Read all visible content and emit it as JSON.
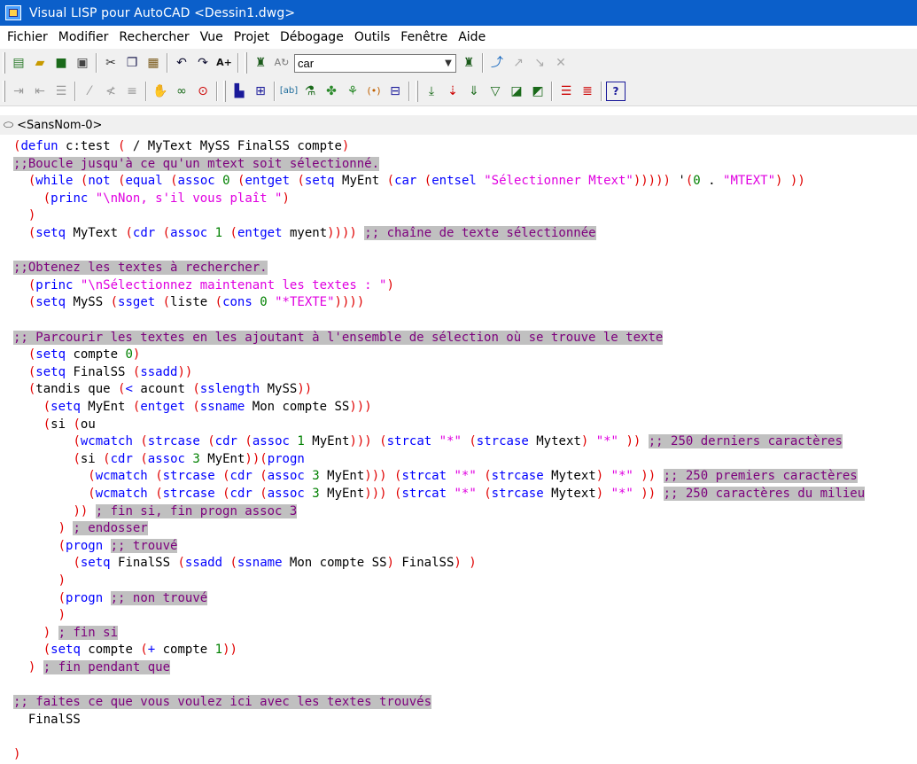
{
  "window": {
    "title": "Visual LISP pour AutoCAD <Dessin1.dwg>"
  },
  "menu": [
    "Fichier",
    "Modifier",
    "Rechercher",
    "Vue",
    "Projet",
    "Débogage",
    "Outils",
    "Fenêtre",
    "Aide"
  ],
  "toolbar": {
    "search_combo_value": "car",
    "row1_buttons": [
      "new-file-icon",
      "open-icon",
      "save-icon",
      "print-icon",
      "cut-icon",
      "copy-icon",
      "paste-icon",
      "undo-icon",
      "redo-icon",
      "complete-word-icon",
      "find-icon",
      "replace-icon",
      "find-toolbar-icon",
      "toggle-bookmark-icon",
      "next-bookmark-icon",
      "clear-bookmarks-icon"
    ],
    "row2_buttons": [
      "indent-icon",
      "unindent-icon",
      "indent-block-icon",
      "comment-icon",
      "uncomment-icon",
      "format-icon",
      "load-selection-icon",
      "check-selection-icon",
      "load-file-icon",
      "activate-autocad-icon",
      "build-output-icon",
      "inspect-icon",
      "watch-icon",
      "apropos-icon",
      "trace-icon",
      "console-icon",
      "step-into-icon",
      "step-over-icon",
      "step-out-icon",
      "continue-icon",
      "quit-icon",
      "reset-icon",
      "toggle-breakpoint-icon",
      "last-break-icon",
      "help-icon"
    ]
  },
  "tab": {
    "label": "<SansNom-0>"
  },
  "code": [
    [
      [
        "p",
        "("
      ],
      [
        "f",
        "defun"
      ],
      [
        "s",
        " c:test "
      ],
      [
        "p",
        "("
      ],
      [
        "s",
        " / MyText MySS FinalSS compte"
      ],
      [
        "p",
        ")"
      ]
    ],
    [
      [
        "c",
        ";;Boucle jusqu'à ce qu'un mtext soit sélectionné."
      ]
    ],
    [
      [
        "s",
        "  "
      ],
      [
        "p",
        "("
      ],
      [
        "f",
        "while"
      ],
      [
        "s",
        " "
      ],
      [
        "p",
        "("
      ],
      [
        "f",
        "not"
      ],
      [
        "s",
        " "
      ],
      [
        "p",
        "("
      ],
      [
        "f",
        "equal"
      ],
      [
        "s",
        " "
      ],
      [
        "p",
        "("
      ],
      [
        "f",
        "assoc"
      ],
      [
        "s",
        " "
      ],
      [
        "n",
        "0"
      ],
      [
        "s",
        " "
      ],
      [
        "p",
        "("
      ],
      [
        "f",
        "entget"
      ],
      [
        "s",
        " "
      ],
      [
        "p",
        "("
      ],
      [
        "f",
        "setq"
      ],
      [
        "s",
        " MyEnt "
      ],
      [
        "p",
        "("
      ],
      [
        "f",
        "car"
      ],
      [
        "s",
        " "
      ],
      [
        "p",
        "("
      ],
      [
        "f",
        "entsel"
      ],
      [
        "s",
        " "
      ],
      [
        "t",
        "\"Sélectionner Mtext\""
      ],
      [
        "p",
        ")))))"
      ],
      [
        "s",
        " '"
      ],
      [
        "p",
        "("
      ],
      [
        "n",
        "0"
      ],
      [
        "s",
        " . "
      ],
      [
        "t",
        "\"MTEXT\""
      ],
      [
        "p",
        ")"
      ],
      [
        "s",
        " "
      ],
      [
        "p",
        "))"
      ]
    ],
    [
      [
        "s",
        "    "
      ],
      [
        "p",
        "("
      ],
      [
        "f",
        "princ"
      ],
      [
        "s",
        " "
      ],
      [
        "t",
        "\"\\nNon, s'il vous plaît \""
      ],
      [
        "p",
        ")"
      ]
    ],
    [
      [
        "s",
        "  "
      ],
      [
        "p",
        ")"
      ]
    ],
    [
      [
        "s",
        "  "
      ],
      [
        "p",
        "("
      ],
      [
        "f",
        "setq"
      ],
      [
        "s",
        " MyText "
      ],
      [
        "p",
        "("
      ],
      [
        "f",
        "cdr"
      ],
      [
        "s",
        " "
      ],
      [
        "p",
        "("
      ],
      [
        "f",
        "assoc"
      ],
      [
        "s",
        " "
      ],
      [
        "n",
        "1"
      ],
      [
        "s",
        " "
      ],
      [
        "p",
        "("
      ],
      [
        "f",
        "entget"
      ],
      [
        "s",
        " myent"
      ],
      [
        "p",
        "))))"
      ],
      [
        "s",
        " "
      ],
      [
        "c",
        ";; chaîne de texte sélectionnée"
      ]
    ],
    [],
    [
      [
        "c",
        ";;Obtenez les textes à rechercher."
      ]
    ],
    [
      [
        "s",
        "  "
      ],
      [
        "p",
        "("
      ],
      [
        "f",
        "princ"
      ],
      [
        "s",
        " "
      ],
      [
        "t",
        "\"\\nSélectionnez maintenant les textes : \""
      ],
      [
        "p",
        ")"
      ]
    ],
    [
      [
        "s",
        "  "
      ],
      [
        "p",
        "("
      ],
      [
        "f",
        "setq"
      ],
      [
        "s",
        " MySS "
      ],
      [
        "p",
        "("
      ],
      [
        "f",
        "ssget"
      ],
      [
        "s",
        " "
      ],
      [
        "p",
        "("
      ],
      [
        "s",
        "liste "
      ],
      [
        "p",
        "("
      ],
      [
        "f",
        "cons"
      ],
      [
        "s",
        " "
      ],
      [
        "n",
        "0"
      ],
      [
        "s",
        " "
      ],
      [
        "t",
        "\"*TEXTE\""
      ],
      [
        "p",
        "))))"
      ]
    ],
    [],
    [
      [
        "c",
        ";; Parcourir les textes en les ajoutant à l'ensemble de sélection où se trouve le texte"
      ]
    ],
    [
      [
        "s",
        "  "
      ],
      [
        "p",
        "("
      ],
      [
        "f",
        "setq"
      ],
      [
        "s",
        " compte "
      ],
      [
        "n",
        "0"
      ],
      [
        "p",
        ")"
      ]
    ],
    [
      [
        "s",
        "  "
      ],
      [
        "p",
        "("
      ],
      [
        "f",
        "setq"
      ],
      [
        "s",
        " FinalSS "
      ],
      [
        "p",
        "("
      ],
      [
        "f",
        "ssadd"
      ],
      [
        "p",
        "))"
      ]
    ],
    [
      [
        "s",
        "  "
      ],
      [
        "p",
        "("
      ],
      [
        "s",
        "tandis que "
      ],
      [
        "p",
        "("
      ],
      [
        "f",
        "<"
      ],
      [
        "s",
        " acount "
      ],
      [
        "p",
        "("
      ],
      [
        "f",
        "sslength"
      ],
      [
        "s",
        " MySS"
      ],
      [
        "p",
        "))"
      ]
    ],
    [
      [
        "s",
        "    "
      ],
      [
        "p",
        "("
      ],
      [
        "f",
        "setq"
      ],
      [
        "s",
        " MyEnt "
      ],
      [
        "p",
        "("
      ],
      [
        "f",
        "entget"
      ],
      [
        "s",
        " "
      ],
      [
        "p",
        "("
      ],
      [
        "f",
        "ssname"
      ],
      [
        "s",
        " Mon compte SS"
      ],
      [
        "p",
        ")))"
      ]
    ],
    [
      [
        "s",
        "    "
      ],
      [
        "p",
        "("
      ],
      [
        "s",
        "si "
      ],
      [
        "p",
        "("
      ],
      [
        "s",
        "ou"
      ]
    ],
    [
      [
        "s",
        "        "
      ],
      [
        "p",
        "("
      ],
      [
        "f",
        "wcmatch"
      ],
      [
        "s",
        " "
      ],
      [
        "p",
        "("
      ],
      [
        "f",
        "strcase"
      ],
      [
        "s",
        " "
      ],
      [
        "p",
        "("
      ],
      [
        "f",
        "cdr"
      ],
      [
        "s",
        " "
      ],
      [
        "p",
        "("
      ],
      [
        "f",
        "assoc"
      ],
      [
        "s",
        " "
      ],
      [
        "n",
        "1"
      ],
      [
        "s",
        " MyEnt"
      ],
      [
        "p",
        ")))"
      ],
      [
        "s",
        " "
      ],
      [
        "p",
        "("
      ],
      [
        "f",
        "strcat"
      ],
      [
        "s",
        " "
      ],
      [
        "t",
        "\"*\""
      ],
      [
        "s",
        " "
      ],
      [
        "p",
        "("
      ],
      [
        "f",
        "strcase"
      ],
      [
        "s",
        " Mytext"
      ],
      [
        "p",
        ")"
      ],
      [
        "s",
        " "
      ],
      [
        "t",
        "\"*\""
      ],
      [
        "s",
        " "
      ],
      [
        "p",
        "))"
      ],
      [
        "s",
        " "
      ],
      [
        "c",
        ";; 250 derniers caractères"
      ]
    ],
    [
      [
        "s",
        "        "
      ],
      [
        "p",
        "("
      ],
      [
        "s",
        "si "
      ],
      [
        "p",
        "("
      ],
      [
        "f",
        "cdr"
      ],
      [
        "s",
        " "
      ],
      [
        "p",
        "("
      ],
      [
        "f",
        "assoc"
      ],
      [
        "s",
        " "
      ],
      [
        "n",
        "3"
      ],
      [
        "s",
        " MyEnt"
      ],
      [
        "p",
        "))("
      ],
      [
        "f",
        "progn"
      ]
    ],
    [
      [
        "s",
        "          "
      ],
      [
        "p",
        "("
      ],
      [
        "f",
        "wcmatch"
      ],
      [
        "s",
        " "
      ],
      [
        "p",
        "("
      ],
      [
        "f",
        "strcase"
      ],
      [
        "s",
        " "
      ],
      [
        "p",
        "("
      ],
      [
        "f",
        "cdr"
      ],
      [
        "s",
        " "
      ],
      [
        "p",
        "("
      ],
      [
        "f",
        "assoc"
      ],
      [
        "s",
        " "
      ],
      [
        "n",
        "3"
      ],
      [
        "s",
        " MyEnt"
      ],
      [
        "p",
        ")))"
      ],
      [
        "s",
        " "
      ],
      [
        "p",
        "("
      ],
      [
        "f",
        "strcat"
      ],
      [
        "s",
        " "
      ],
      [
        "t",
        "\"*\""
      ],
      [
        "s",
        " "
      ],
      [
        "p",
        "("
      ],
      [
        "f",
        "strcase"
      ],
      [
        "s",
        " Mytext"
      ],
      [
        "p",
        ")"
      ],
      [
        "s",
        " "
      ],
      [
        "t",
        "\"*\""
      ],
      [
        "s",
        " "
      ],
      [
        "p",
        "))"
      ],
      [
        "s",
        " "
      ],
      [
        "c",
        ";; 250 premiers caractères"
      ]
    ],
    [
      [
        "s",
        "          "
      ],
      [
        "p",
        "("
      ],
      [
        "f",
        "wcmatch"
      ],
      [
        "s",
        " "
      ],
      [
        "p",
        "("
      ],
      [
        "f",
        "strcase"
      ],
      [
        "s",
        " "
      ],
      [
        "p",
        "("
      ],
      [
        "f",
        "cdr"
      ],
      [
        "s",
        " "
      ],
      [
        "p",
        "("
      ],
      [
        "f",
        "assoc"
      ],
      [
        "s",
        " "
      ],
      [
        "n",
        "3"
      ],
      [
        "s",
        " MyEnt"
      ],
      [
        "p",
        ")))"
      ],
      [
        "s",
        " "
      ],
      [
        "p",
        "("
      ],
      [
        "f",
        "strcat"
      ],
      [
        "s",
        " "
      ],
      [
        "t",
        "\"*\""
      ],
      [
        "s",
        " "
      ],
      [
        "p",
        "("
      ],
      [
        "f",
        "strcase"
      ],
      [
        "s",
        " Mytext"
      ],
      [
        "p",
        ")"
      ],
      [
        "s",
        " "
      ],
      [
        "t",
        "\"*\""
      ],
      [
        "s",
        " "
      ],
      [
        "p",
        "))"
      ],
      [
        "s",
        " "
      ],
      [
        "c",
        ";; 250 caractères du milieu"
      ]
    ],
    [
      [
        "s",
        "        "
      ],
      [
        "p",
        "))"
      ],
      [
        "s",
        " "
      ],
      [
        "c",
        "; fin si, fin progn assoc 3"
      ]
    ],
    [
      [
        "s",
        "      "
      ],
      [
        "p",
        ")"
      ],
      [
        "s",
        " "
      ],
      [
        "c",
        "; endosser"
      ]
    ],
    [
      [
        "s",
        "      "
      ],
      [
        "p",
        "("
      ],
      [
        "f",
        "progn"
      ],
      [
        "s",
        " "
      ],
      [
        "c",
        ";; trouvé"
      ]
    ],
    [
      [
        "s",
        "        "
      ],
      [
        "p",
        "("
      ],
      [
        "f",
        "setq"
      ],
      [
        "s",
        " FinalSS "
      ],
      [
        "p",
        "("
      ],
      [
        "f",
        "ssadd"
      ],
      [
        "s",
        " "
      ],
      [
        "p",
        "("
      ],
      [
        "f",
        "ssname"
      ],
      [
        "s",
        " Mon compte SS"
      ],
      [
        "p",
        ")"
      ],
      [
        "s",
        " FinalSS"
      ],
      [
        "p",
        ")"
      ],
      [
        "s",
        " "
      ],
      [
        "p",
        ")"
      ]
    ],
    [
      [
        "s",
        "      "
      ],
      [
        "p",
        ")"
      ]
    ],
    [
      [
        "s",
        "      "
      ],
      [
        "p",
        "("
      ],
      [
        "f",
        "progn"
      ],
      [
        "s",
        " "
      ],
      [
        "c",
        ";; non trouvé"
      ]
    ],
    [
      [
        "s",
        "      "
      ],
      [
        "p",
        ")"
      ]
    ],
    [
      [
        "s",
        "    "
      ],
      [
        "p",
        ")"
      ],
      [
        "s",
        " "
      ],
      [
        "c",
        "; fin si"
      ]
    ],
    [
      [
        "s",
        "    "
      ],
      [
        "p",
        "("
      ],
      [
        "f",
        "setq"
      ],
      [
        "s",
        " compte "
      ],
      [
        "p",
        "("
      ],
      [
        "f",
        "+"
      ],
      [
        "s",
        " compte "
      ],
      [
        "n",
        "1"
      ],
      [
        "p",
        "))"
      ]
    ],
    [
      [
        "s",
        "  "
      ],
      [
        "p",
        ")"
      ],
      [
        "s",
        " "
      ],
      [
        "c",
        "; fin pendant que"
      ]
    ],
    [],
    [
      [
        "c",
        ";; faites ce que vous voulez ici avec les textes trouvés"
      ]
    ],
    [
      [
        "s",
        "  FinalSS"
      ]
    ],
    [],
    [
      [
        "p",
        ")"
      ]
    ]
  ]
}
